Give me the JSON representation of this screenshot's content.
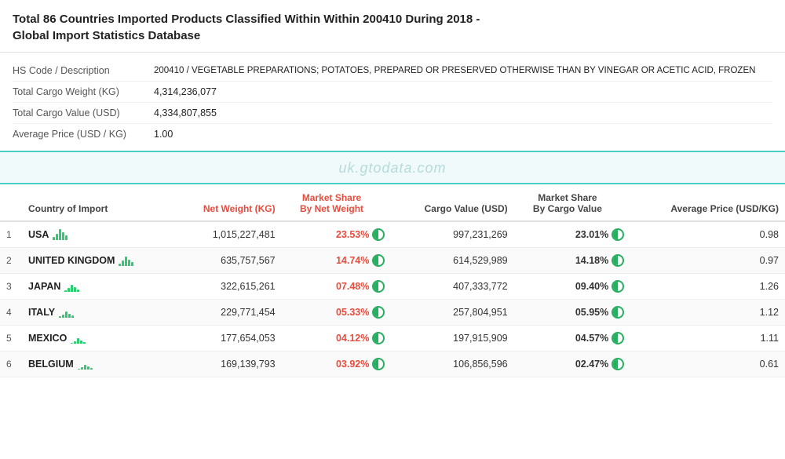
{
  "header": {
    "title_bold": "Total 86 Countries Imported Products Classified Within Within 200410 During 2018",
    "title_suffix": " -",
    "subtitle": "Global Import Statistics Database"
  },
  "info_rows": [
    {
      "label": "HS Code / Description",
      "value": "200410 / VEGETABLE PREPARATIONS; POTATOES, PREPARED OR PRESERVED OTHERWISE THAN BY VINEGAR OR ACETIC ACID, FROZEN"
    },
    {
      "label": "Total Cargo Weight (KG)",
      "value": "4,314,236,077"
    },
    {
      "label": "Total Cargo Value (USD)",
      "value": "4,334,807,855"
    },
    {
      "label": "Average Price (USD / KG)",
      "value": "1.00"
    }
  ],
  "watermark": "uk.gtodata.com",
  "table": {
    "columns": [
      {
        "id": "rank",
        "label": "",
        "className": "rank-col"
      },
      {
        "id": "country",
        "label": "Country of Import",
        "className": ""
      },
      {
        "id": "net_weight",
        "label": "Net Weight (KG)",
        "className": "num-col red-header"
      },
      {
        "id": "market_share_weight",
        "label": "Market Share By Net Weight",
        "className": "center-col red-header"
      },
      {
        "id": "cargo_value",
        "label": "Cargo Value (USD)",
        "className": "num-col"
      },
      {
        "id": "market_share_cargo",
        "label": "Market Share By Cargo Value",
        "className": "center-col"
      },
      {
        "id": "avg_price",
        "label": "Average Price (USD/KG)",
        "className": "num-col"
      }
    ],
    "rows": [
      {
        "rank": "1",
        "country": "USA",
        "net_weight": "1,015,227,481",
        "market_share_weight": "23.53%",
        "cargo_value": "997,231,269",
        "market_share_cargo": "23.01%",
        "avg_price": "0.98"
      },
      {
        "rank": "2",
        "country": "UNITED KINGDOM",
        "net_weight": "635,757,567",
        "market_share_weight": "14.74%",
        "cargo_value": "614,529,989",
        "market_share_cargo": "14.18%",
        "avg_price": "0.97"
      },
      {
        "rank": "3",
        "country": "JAPAN",
        "net_weight": "322,615,261",
        "market_share_weight": "07.48%",
        "cargo_value": "407,333,772",
        "market_share_cargo": "09.40%",
        "avg_price": "1.26"
      },
      {
        "rank": "4",
        "country": "ITALY",
        "net_weight": "229,771,454",
        "market_share_weight": "05.33%",
        "cargo_value": "257,804,951",
        "market_share_cargo": "05.95%",
        "avg_price": "1.12"
      },
      {
        "rank": "5",
        "country": "MEXICO",
        "net_weight": "177,654,053",
        "market_share_weight": "04.12%",
        "cargo_value": "197,915,909",
        "market_share_cargo": "04.57%",
        "avg_price": "1.11"
      },
      {
        "rank": "6",
        "country": "BELGIUM",
        "net_weight": "169,139,793",
        "market_share_weight": "03.92%",
        "cargo_value": "106,856,596",
        "market_share_cargo": "02.47%",
        "avg_price": "0.61"
      }
    ],
    "partial_row": {
      "rank": "6",
      "country": "BELGIUM",
      "net_weight": "169,139,793",
      "market_share_weight": "03.92%",
      "cargo_value": "106,856,596",
      "market_share_cargo": "02.47%",
      "avg_price": "0.61"
    }
  },
  "bar_heights": {
    "USA": [
      4,
      8,
      14,
      10,
      6
    ],
    "UNITED KINGDOM": [
      3,
      7,
      12,
      8,
      5
    ],
    "JAPAN": [
      2,
      5,
      9,
      6,
      3
    ],
    "ITALY": [
      2,
      4,
      8,
      5,
      3
    ],
    "MEXICO": [
      1,
      3,
      7,
      4,
      2
    ],
    "BELGIUM": [
      1,
      3,
      6,
      4,
      2
    ]
  }
}
